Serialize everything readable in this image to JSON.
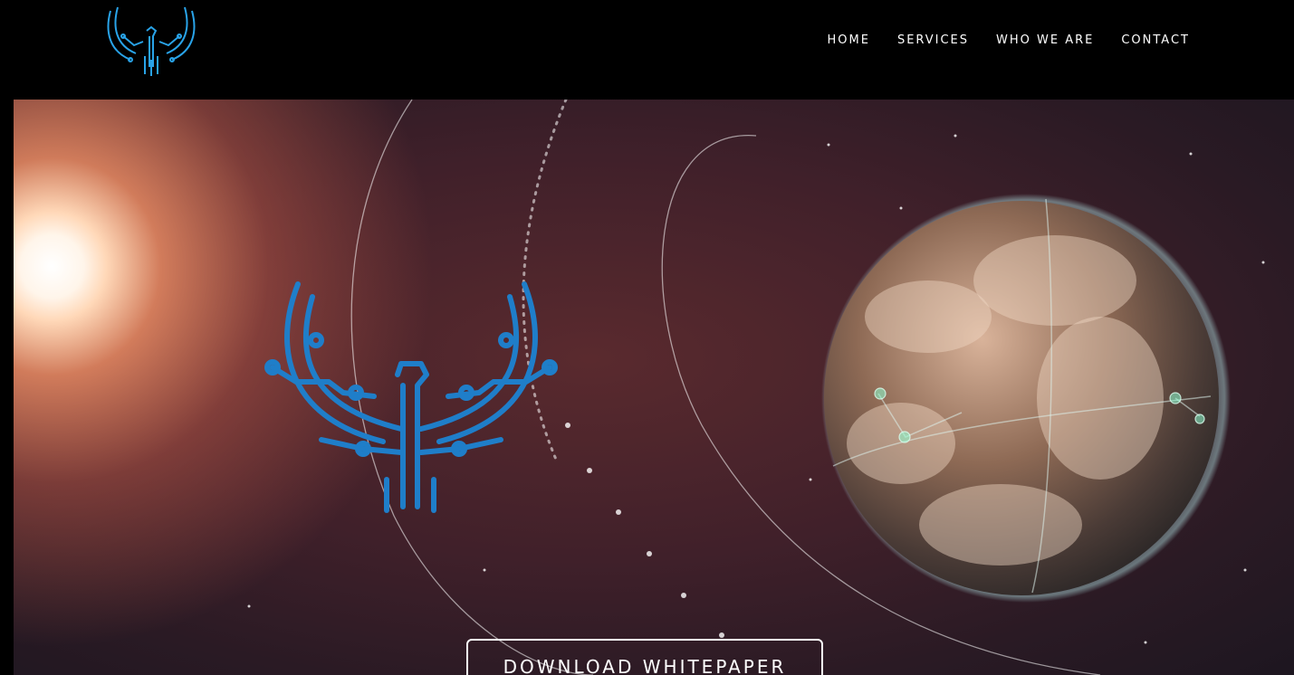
{
  "nav": {
    "items": [
      {
        "label": "HOME"
      },
      {
        "label": "SERVICES"
      },
      {
        "label": "WHO WE ARE"
      },
      {
        "label": "CONTACT"
      }
    ]
  },
  "hero": {
    "cta_label": "DOWNLOAD WHITEPAPER"
  },
  "colors": {
    "logo_blue": "#1f7ec9",
    "header_bg": "#000000",
    "text": "#ffffff"
  }
}
